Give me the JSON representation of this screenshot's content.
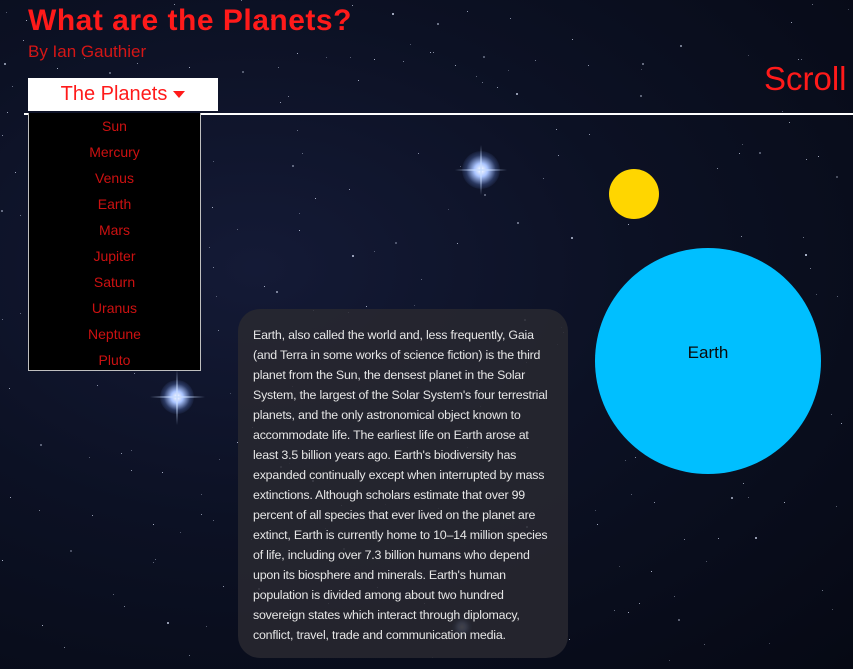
{
  "header": {
    "title": "What are the Planets?",
    "byline": "By Ian Gauthier",
    "scroll_hint": "Scroll to"
  },
  "dropdown": {
    "label": "The Planets",
    "icon": "caret-down-icon",
    "items": [
      "Sun",
      "Mercury",
      "Venus",
      "Earth",
      "Mars",
      "Jupiter",
      "Saturn",
      "Uranus",
      "Neptune",
      "Pluto"
    ]
  },
  "scene": {
    "planet_label": "Earth",
    "sun_color": "#ffd600",
    "planet_color": "#00bfff"
  },
  "info": {
    "text": "Earth, also called the world and, less frequently, Gaia (and Terra in some works of science fiction) is the third planet from the Sun, the densest planet in the Solar System, the largest of the Solar System's four terrestrial planets, and the only astronomical object known to accommodate life. The earliest life on Earth arose at least 3.5 billion years ago. Earth's biodiversity has expanded continually except when interrupted by mass extinctions. Although scholars estimate that over 99 percent of all species that ever lived on the planet are extinct, Earth is currently home to 10–14 million species of life, including over 7.3 billion humans who depend upon its biosphere and minerals. Earth's human population is divided among about two hundred sovereign states which interact through diplomacy, conflict, travel, trade and communication media."
  },
  "colors": {
    "accent": "#ff1a1a",
    "menu_text": "#cc1111",
    "background": "#0c1124"
  }
}
